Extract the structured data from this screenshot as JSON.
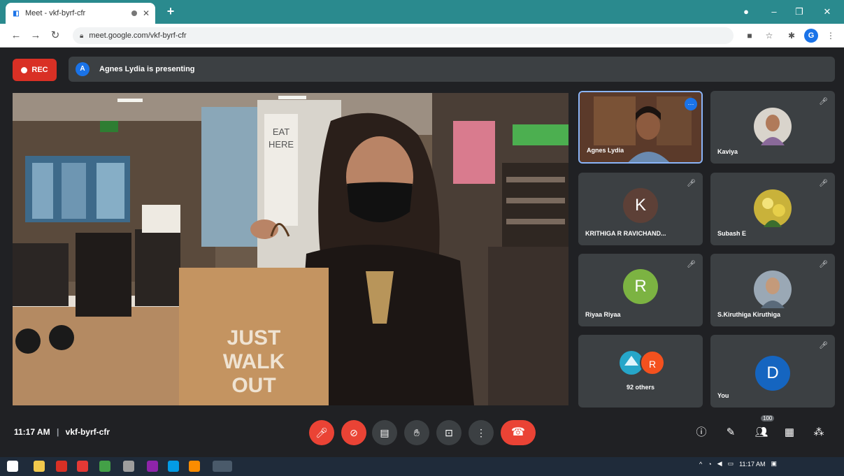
{
  "browser": {
    "tab_title": "Meet - vkf-byrf-cfr",
    "url": "meet.google.com/vkf-byrf-cfr",
    "profile_initial": "G"
  },
  "meet": {
    "rec_label": "REC",
    "presenter_initial": "A",
    "presenting_text": "Agnes Lydia is presenting",
    "meeting_time": "11:17 AM",
    "meeting_code": "vkf-byrf-cfr",
    "people_count": "100"
  },
  "participants": [
    {
      "name": "Agnes Lydia",
      "type": "video"
    },
    {
      "name": "Kaviya",
      "type": "photo"
    },
    {
      "name": "KRITHIGA R RAVICHAND...",
      "initial": "K",
      "color": "#5d4037"
    },
    {
      "name": "Subash E",
      "type": "photo"
    },
    {
      "name": "Riyaa Riyaa",
      "initial": "R",
      "color": "#7cb342"
    },
    {
      "name": "S.Kiruthiga Kiruthiga",
      "type": "photo"
    },
    {
      "name": "92 others",
      "initial": "R",
      "color": "#f4511e"
    },
    {
      "name": "You",
      "initial": "D",
      "color": "#1565c0"
    }
  ],
  "video": {
    "bag_text_line1": "JUST",
    "bag_text_line2": "WALK",
    "bag_text_line3": "OUT",
    "sign_text_1": "EAT",
    "sign_text_2": "HERE"
  },
  "colors": {
    "tab_strip": "#2a8a8e",
    "rec_red": "#d93025",
    "control_red": "#ea4335",
    "tile_bg": "#3c4043"
  },
  "taskbar": {
    "time": "11:17 AM"
  }
}
